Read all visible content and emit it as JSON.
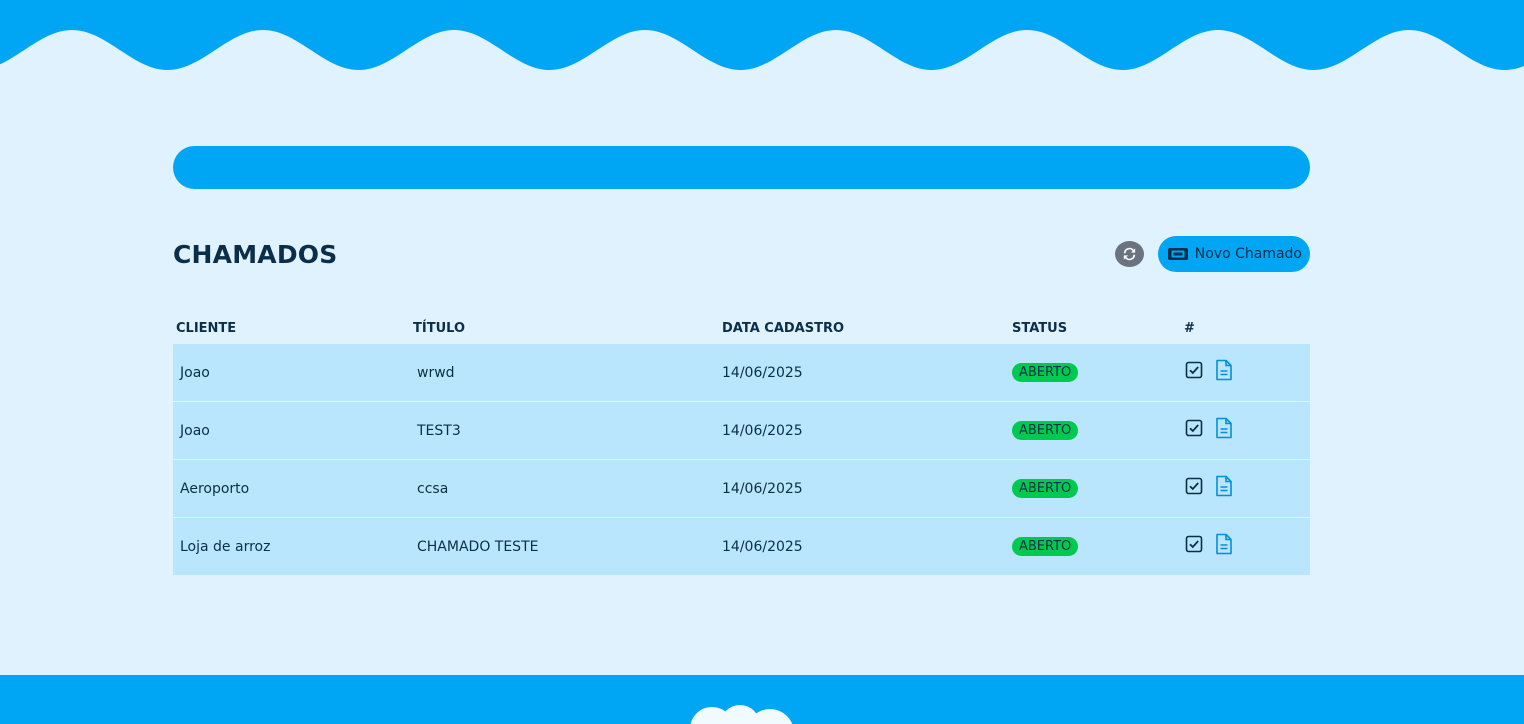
{
  "page": {
    "title": "CHAMADOS",
    "new_button_label": "Novo Chamado",
    "refresh_icon": "refresh-icon",
    "ticket_icon": "ticket-icon"
  },
  "table": {
    "headers": [
      "CLIENTE",
      "TÍTULO",
      "DATA CADASTRO",
      "STATUS",
      "#"
    ],
    "rows": [
      {
        "cliente": "Joao",
        "titulo": "wrwd",
        "data": "14/06/2025",
        "status": "ABERTO"
      },
      {
        "cliente": "Joao",
        "titulo": "TEST3",
        "data": "14/06/2025",
        "status": "ABERTO"
      },
      {
        "cliente": "Aeroporto",
        "titulo": "ccsa",
        "data": "14/06/2025",
        "status": "ABERTO"
      },
      {
        "cliente": "Loja de arroz",
        "titulo": "CHAMADO TESTE",
        "data": "14/06/2025",
        "status": "ABERTO"
      }
    ],
    "row_action_icons": [
      "check-square-icon",
      "document-icon"
    ]
  },
  "colors": {
    "background": "#dff2fe",
    "primary": "#00a6f4",
    "row": "#b9e6fd",
    "text": "#0b2e4a",
    "status_open": "#00c950",
    "refresh": "#6b7280"
  }
}
